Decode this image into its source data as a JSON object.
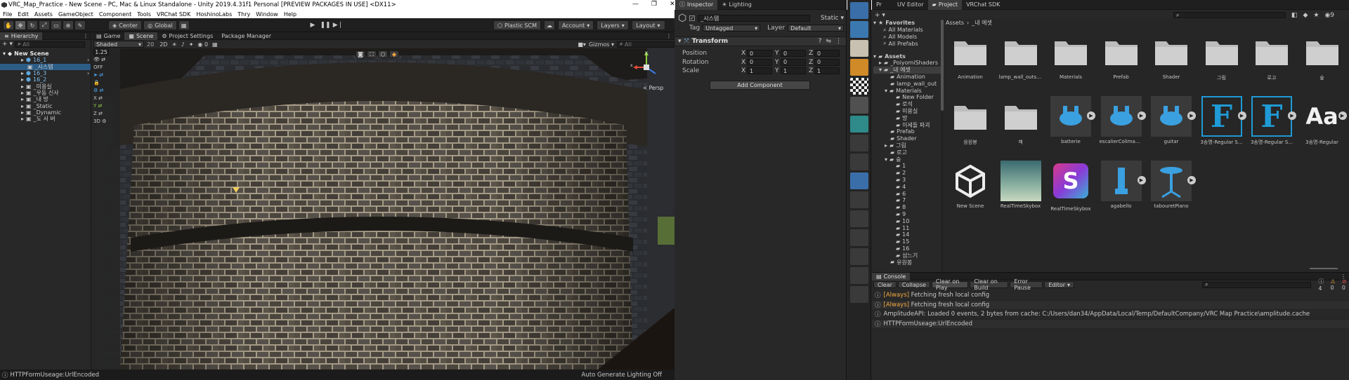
{
  "window": {
    "title": "VRC_Map_Practice - New Scene - PC, Mac & Linux Standalone - Unity 2019.4.31f1 Personal [PREVIEW PACKAGES IN USE] <DX11>"
  },
  "menu": [
    "File",
    "Edit",
    "Assets",
    "GameObject",
    "Component",
    "Tools",
    "VRChat SDK",
    "HoshinoLabs",
    "Thry",
    "Window",
    "Help"
  ],
  "toolbar": {
    "center": "Center",
    "global": "Global",
    "plastic": "Plastic SCM",
    "account": "Account",
    "layers": "Layers",
    "layout": "Layout"
  },
  "hierarchy": {
    "tab": "Hierarchy",
    "search_placeholder": "All",
    "scene": "New Scene",
    "items": [
      "16_1",
      "_시스템",
      "16_3",
      "16_2",
      "_미용실",
      "_우동 신사",
      "_내 방",
      "_Static",
      "_Dynamic",
      "_도 서 버"
    ]
  },
  "scene": {
    "tabs": [
      "Game",
      "Scene",
      "Project Settings",
      "Package Manager"
    ],
    "shading": "Shaded",
    "gizmos": "Gizmos",
    "search_placeholder": "All",
    "camera_speed": "1.25",
    "off_label": "OFF",
    "persp": "< Persp",
    "scale_value": "20"
  },
  "status": {
    "left": "HTTPFormUseage:UrlEncoded",
    "right": "Auto Generate Lighting Off"
  },
  "inspector": {
    "tabs": [
      "Inspector",
      "Lighting"
    ],
    "object_name": "_시스템",
    "static": "Static",
    "tag_label": "Tag",
    "tag": "Untagged",
    "layer_label": "Layer",
    "layer": "Default",
    "component": "Transform",
    "rows": [
      {
        "label": "Position",
        "x": "0",
        "y": "0",
        "z": "0"
      },
      {
        "label": "Rotation",
        "x": "0",
        "y": "0",
        "z": "0"
      },
      {
        "label": "Scale",
        "x": "1",
        "y": "1",
        "z": "1"
      }
    ],
    "add_component": "Add Component"
  },
  "project": {
    "tabs": [
      "Pr",
      "UV Editor",
      "Project",
      "VRChat SDK"
    ],
    "breadcrumb": [
      "Assets",
      "_내 에셋"
    ],
    "favorites_label": "Favorites",
    "favorites": [
      "All Materials",
      "All Models",
      "All Prefabs"
    ],
    "assets_label": "Assets",
    "tree": [
      "_PoiyomiShaders",
      "_내 에셋",
      "Animation",
      "lamp_wall_out",
      "Materials",
      "New Folder",
      "로석",
      "미용실",
      "방",
      "이세돌 파괴",
      "Prefab",
      "Shader",
      "그림",
      "로고",
      "숲",
      "1",
      "2",
      "3",
      "4",
      "6",
      "7",
      "8",
      "9",
      "10",
      "11",
      "14",
      "15",
      "16",
      "섬느기",
      "유원봉"
    ],
    "assets": [
      {
        "name": "Animation",
        "kind": "folder"
      },
      {
        "name": "lamp_wall_outsi...",
        "kind": "folder"
      },
      {
        "name": "Materials",
        "kind": "folder"
      },
      {
        "name": "Prefab",
        "kind": "folder"
      },
      {
        "name": "Shader",
        "kind": "folder"
      },
      {
        "name": "그림",
        "kind": "folder"
      },
      {
        "name": "로고",
        "kind": "folder"
      },
      {
        "name": "숲",
        "kind": "folder"
      },
      {
        "name": "응원봉",
        "kind": "folder"
      },
      {
        "name": "책",
        "kind": "folder"
      },
      {
        "name": "batterie",
        "kind": "model"
      },
      {
        "name": "escalierColimaco...",
        "kind": "model"
      },
      {
        "name": "guitar",
        "kind": "model"
      },
      {
        "name": "3송명-Regular S...",
        "kind": "font-sel"
      },
      {
        "name": "3송명-Regular S...",
        "kind": "font-sel"
      },
      {
        "name": "3송명-Regular",
        "kind": "font"
      },
      {
        "name": "New Scene",
        "kind": "unity"
      },
      {
        "name": "RealTimeSkybox",
        "kind": "sky"
      },
      {
        "name": "RealTimeSkybox",
        "kind": "shader"
      },
      {
        "name": "agabello",
        "kind": "model2"
      },
      {
        "name": "tabouretPiano",
        "kind": "model3"
      }
    ],
    "font_glyph": "F",
    "font_glyph2": "Aa",
    "shader_glyph": "S"
  },
  "console": {
    "tab": "Console",
    "buttons": [
      "Clear",
      "Collapse",
      "Clear on Play",
      "Clear on Build",
      "Error Pause",
      "Editor"
    ],
    "counts": [
      "4",
      "0",
      "0"
    ],
    "lines": [
      {
        "tag": "[Always]",
        "text": " Fetching fresh local config"
      },
      {
        "tag": "[Always]",
        "text": " Fetching fresh local config"
      },
      {
        "tag": "",
        "text": "AmplitudeAPI: Loaded 0 events, 2 bytes from cache: C:/Users/dan34/AppData/Local/Temp/DefaultCompany/VRC Map Practice\\amplitude.cache"
      },
      {
        "tag": "",
        "text": "HTTPFormUseage:UrlEncoded"
      }
    ]
  },
  "colors": {
    "accent": "#2c5d87",
    "selection_blue": "#1f9ad6",
    "warning": "#f2a640"
  }
}
